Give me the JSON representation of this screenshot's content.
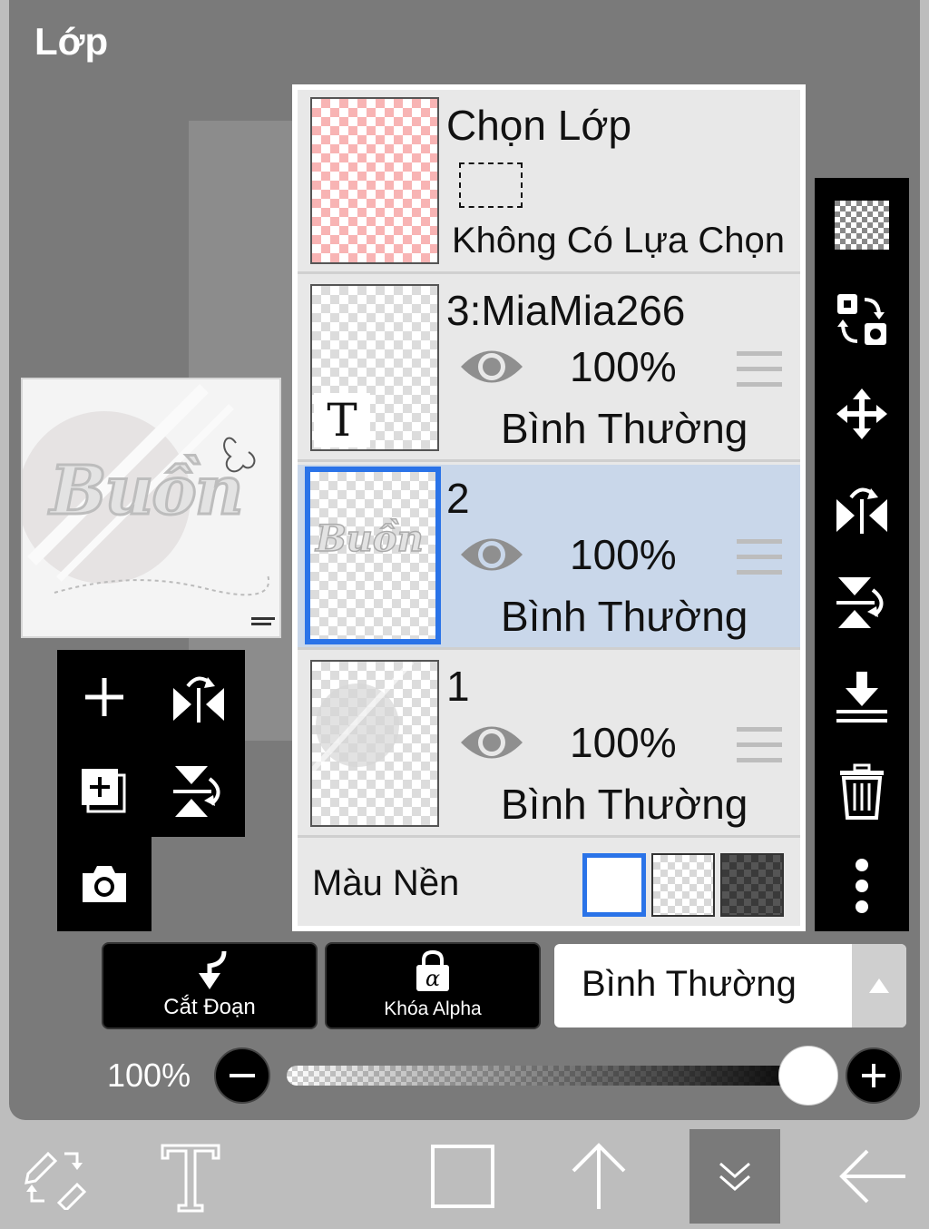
{
  "panel": {
    "title": "Lớp"
  },
  "layers_panel": {
    "selection_layer": {
      "title": "Chọn Lớp",
      "status": "Không Có Lựa Chọn"
    },
    "layers": [
      {
        "name": "3:MiaMia266",
        "opacity": "100%",
        "blend": "Bình Thường",
        "type": "text",
        "thumb_text": "T",
        "selected": false
      },
      {
        "name": "2",
        "opacity": "100%",
        "blend": "Bình Thường",
        "type": "image",
        "thumb_text": "Buồn",
        "selected": true
      },
      {
        "name": "1",
        "opacity": "100%",
        "blend": "Bình Thường",
        "type": "image",
        "thumb_text": "",
        "selected": false
      }
    ],
    "background": {
      "label": "Màu Nền",
      "options": [
        "white",
        "transparent",
        "dark"
      ],
      "selected": "white"
    }
  },
  "preview": {
    "text": "Buồn"
  },
  "left_tools": [
    "add-layer",
    "flip-horizontal",
    "add-layer-copy",
    "flip-vertical",
    "camera"
  ],
  "right_tools": [
    "transparency",
    "swap-layers",
    "move",
    "flip-horizontal",
    "flip-vertical",
    "merge-down",
    "delete",
    "more"
  ],
  "actions": {
    "clipping": "Cắt Đoạn",
    "alpha_lock": "Khóa Alpha",
    "blend_mode": "Bình Thường"
  },
  "opacity": {
    "label": "100%",
    "value": 1.0
  },
  "bottom_bar": [
    "edit-tools",
    "text-tool",
    "square",
    "arrow-up",
    "chevron-down",
    "back-arrow"
  ],
  "colors": {
    "accent": "#2a73e8",
    "panel_bg": "#7a7a7a",
    "active_row": "#c9d7ea"
  }
}
